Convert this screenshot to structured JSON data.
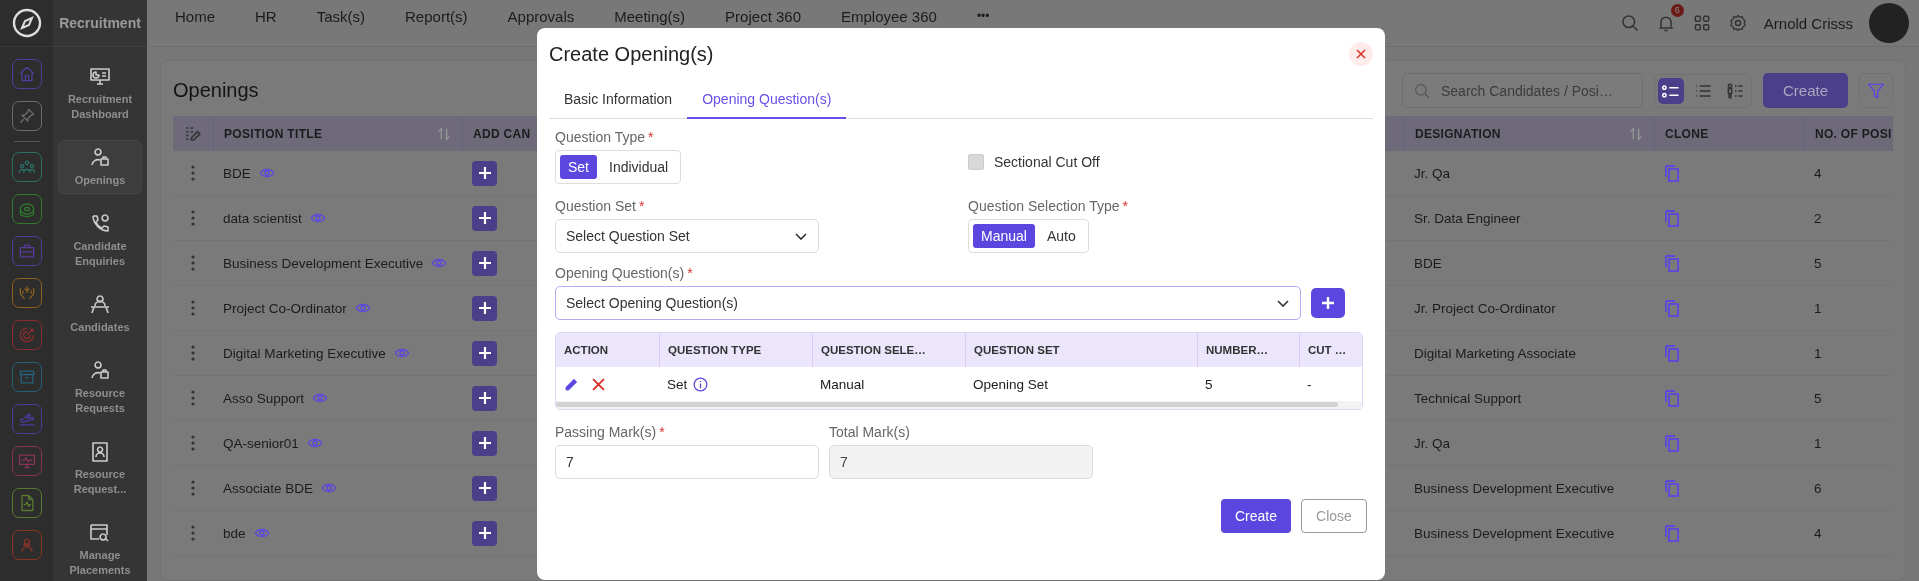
{
  "app": {
    "name": "Recruitment"
  },
  "rail": {
    "top": [
      {
        "color": "#4a3f99"
      },
      {
        "color": "#6a6a6a"
      }
    ],
    "apps": [
      {
        "color": "#2a6e64"
      },
      {
        "color": "#2f7a2f"
      },
      {
        "color": "#553a99"
      },
      {
        "color": "#8a6020"
      },
      {
        "color": "#8a2c30"
      },
      {
        "color": "#25627a"
      },
      {
        "color": "#4c3a99"
      },
      {
        "color": "#883258"
      },
      {
        "color": "#587a2e"
      },
      {
        "color": "#8a3424"
      }
    ]
  },
  "sidebar": {
    "items": [
      {
        "label": "Recruitment Dashboard",
        "selected": false
      },
      {
        "label": "Openings",
        "selected": true
      },
      {
        "label": "Candidate Enquiries",
        "selected": false
      },
      {
        "label": "Candidates",
        "selected": false
      },
      {
        "label": "Resource Requests",
        "selected": false
      },
      {
        "label": "Resource Request...",
        "selected": false
      },
      {
        "label": "Manage Placements",
        "selected": false
      }
    ]
  },
  "nav": {
    "items": [
      "Home",
      "HR",
      "Task(s)",
      "Report(s)",
      "Approvals",
      "Meeting(s)",
      "Project 360",
      "Employee 360"
    ],
    "more": "•••"
  },
  "header": {
    "notifications": "6",
    "user": "Arnold Crisss"
  },
  "page": {
    "title": "Openings",
    "search": {
      "placeholder": "Search Candidates / Posi…"
    },
    "views": [
      {
        "selected": true
      },
      {
        "selected": false
      },
      {
        "selected": false
      }
    ],
    "create": "Create"
  },
  "table": {
    "columns": [
      "POSITION TITLE",
      "ADD CAN",
      "DESIGNATION",
      "CLONE",
      "NO. OF POSI"
    ],
    "rows": [
      {
        "position_title": "BDE",
        "designation": "Jr. Qa",
        "positions": "4"
      },
      {
        "position_title": "data scientist",
        "designation": "Sr. Data Engineer",
        "positions": "2"
      },
      {
        "position_title": "Business Development Executive",
        "designation": "BDE",
        "positions": "5"
      },
      {
        "position_title": "Project Co-Ordinator",
        "designation": "Jr. Project Co-Ordinator",
        "positions": "1"
      },
      {
        "position_title": "Digital Marketing Executive",
        "designation": "Digital Marketing Associate",
        "positions": "1"
      },
      {
        "position_title": "Asso Support",
        "designation": "Technical Support",
        "positions": "5"
      },
      {
        "position_title": "QA-senior01",
        "designation": "Jr. Qa",
        "positions": "1"
      },
      {
        "position_title": "Associate BDE",
        "designation": "Business Development Executive",
        "positions": "6"
      },
      {
        "position_title": "bde",
        "designation": "Business Development Executive",
        "positions": "4"
      }
    ]
  },
  "modal": {
    "title": "Create Opening(s)",
    "tabs": [
      {
        "label": "Basic Information",
        "selected": false
      },
      {
        "label": "Opening Question(s)",
        "selected": true
      }
    ],
    "question_type": {
      "label": "Question Type",
      "required_mark": "*",
      "options": [
        {
          "label": "Set",
          "selected": true
        },
        {
          "label": "Individual",
          "selected": false
        }
      ]
    },
    "sectional_cut_off": {
      "label": "Sectional Cut Off",
      "checked": false
    },
    "question_set": {
      "label": "Question Set",
      "required_mark": "*",
      "placeholder": "Select Question Set"
    },
    "selection_type": {
      "label": "Question Selection Type",
      "required_mark": "*",
      "options": [
        {
          "label": "Manual",
          "selected": true
        },
        {
          "label": "Auto",
          "selected": false
        }
      ]
    },
    "opening_questions": {
      "label": "Opening Question(s)",
      "required_mark": "*",
      "placeholder": "Select Opening Question(s)"
    },
    "questions_table": {
      "columns": [
        "ACTION",
        "QUESTION TYPE",
        "QUESTION SELE…",
        "QUESTION SET",
        "NUMBER…",
        "CUT …"
      ],
      "rows": [
        {
          "question_type": "Set",
          "selection": "Manual",
          "question_set": "Opening Set",
          "number": "5",
          "cut_off": "-"
        }
      ]
    },
    "passing_marks": {
      "label": "Passing Mark(s)",
      "required_mark": "*",
      "value": "7"
    },
    "total_marks": {
      "label": "Total Mark(s)",
      "value": "7",
      "disabled": true
    },
    "buttons": [
      {
        "label": "Create",
        "kind": "primary"
      },
      {
        "label": "Close",
        "kind": "secondary"
      }
    ]
  }
}
